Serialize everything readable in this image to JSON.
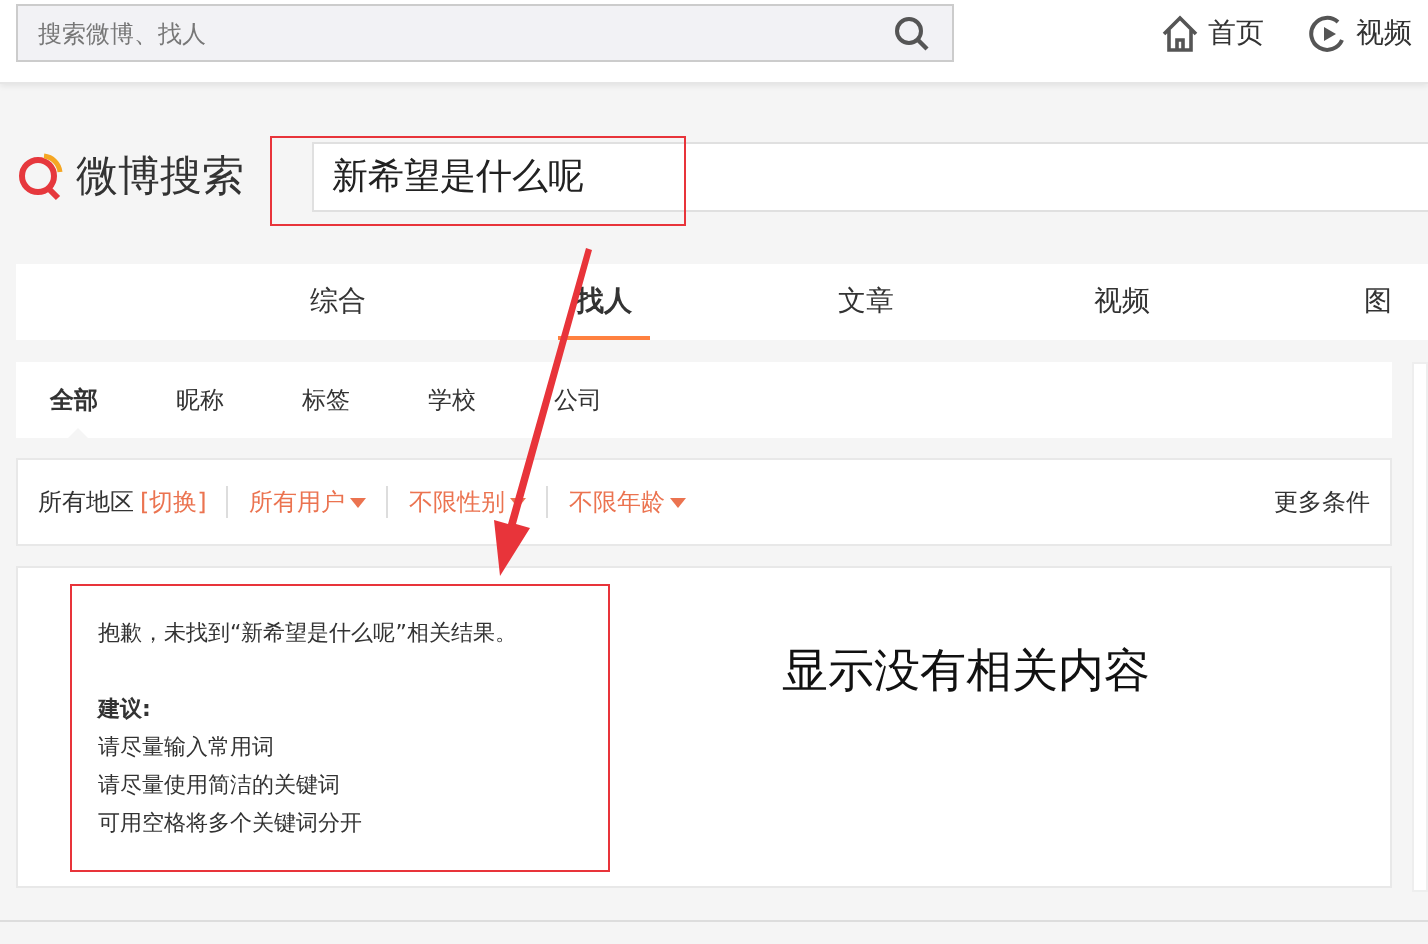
{
  "top_bar": {
    "search": {
      "placeholder": "搜索微博、找人"
    },
    "nav": [
      {
        "label": "首页"
      },
      {
        "label": "视频"
      }
    ]
  },
  "logo": {
    "text": "微博搜索"
  },
  "query": {
    "value": "新希望是什么呢"
  },
  "tabs": [
    {
      "label": "综合",
      "selected": false
    },
    {
      "label": "找人",
      "selected": true
    },
    {
      "label": "文章",
      "selected": false
    },
    {
      "label": "视频",
      "selected": false
    },
    {
      "label": "图",
      "selected": false
    }
  ],
  "sub_tabs": [
    {
      "label": "全部",
      "selected": true
    },
    {
      "label": "昵称",
      "selected": false
    },
    {
      "label": "标签",
      "selected": false
    },
    {
      "label": "学校",
      "selected": false
    },
    {
      "label": "公司",
      "selected": false
    }
  ],
  "filters": {
    "region": "所有地区",
    "switch": "[切换]",
    "dropdowns": [
      "所有用户",
      "不限性别",
      "不限年龄"
    ],
    "more": "更多条件"
  },
  "result": {
    "message": "抱歉，未找到“新希望是什么呢”相关结果。",
    "suggestion_title": "建议:",
    "suggestions": [
      "请尽量输入常用词",
      "请尽量使用简洁的关键词",
      "可用空格将多个关键词分开"
    ]
  },
  "annotation": {
    "text": "显示没有相关内容"
  }
}
